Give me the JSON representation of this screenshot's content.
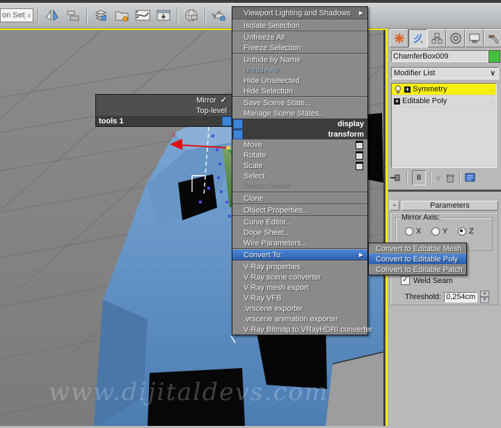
{
  "glyphs": {
    "check": "✓",
    "submenu_arrow": "▶",
    "chevron_down": "∨",
    "spinner_up": "▲",
    "spinner_down": "▼",
    "collapse": "-",
    "show_end_result": "II",
    "make_unique": "∨",
    "stack_dots": "·.",
    "plus": "+"
  },
  "toolbar": {
    "selection_set_value": "on Set",
    "icons": [
      "mirror",
      "align",
      "layer-manager",
      "scene-explorer",
      "curve-editor",
      "schematic-view",
      "render-setup",
      "rendered-frame-window",
      "render-production"
    ]
  },
  "menus": {
    "left_quad": {
      "items": [
        "Mirror",
        "Top-level"
      ],
      "bar": "tools 1"
    },
    "bars": {
      "display": "display",
      "transform": "transform"
    },
    "display_items": [
      "Viewport Lighting and Shadows",
      "Isolate Selection",
      "Unfreeze All",
      "Freeze Selection",
      "Unhide by Name",
      "Unhide All",
      "Hide Unselected",
      "Hide Selection",
      "Save Scene State...",
      "Manage Scene States..."
    ],
    "transform_items": [
      "Move",
      "Rotate",
      "Scale",
      "Select",
      "Select Similar",
      "Clone",
      "Object Properties...",
      "Curve Editor...",
      "Dope Sheet...",
      "Wire Parameters...",
      "Convert To:",
      "V-Ray properties",
      "V-Ray scene converter",
      "V-Ray mesh export",
      "V-Ray VFB",
      ".vrscene exporter",
      ".vrscene animation exporter",
      "V-Ray Bitmap to VRayHDRI converter"
    ],
    "submenu_items": [
      "Convert to Editable Mesh",
      "Convert to Editable Poly",
      "Convert to Editable Patch"
    ],
    "highlighted_item": "Convert To:",
    "highlighted_submenu_item": "Convert to Editable Poly"
  },
  "viewport": {
    "axis_label": "x"
  },
  "panel": {
    "tabs": [
      "create",
      "modify",
      "hierarchy",
      "motion",
      "display",
      "utilities"
    ],
    "selected_tab": "modify",
    "object_name": "ChamferBox009",
    "modifier_list": "Modifier List",
    "stack": [
      "Symmetry",
      "Editable Poly"
    ],
    "stack_selected": "Symmetry",
    "rollout": {
      "title": "Parameters"
    },
    "mirror_axis": {
      "label": "Mirror Axis:",
      "options": [
        "X",
        "Y",
        "Z"
      ],
      "selected": "Z"
    },
    "weld_seam_label": "Weld Seam",
    "weld_seam_checked": true,
    "threshold_label": "Threshold:",
    "threshold_value": "0,254cm"
  },
  "watermark": "www.dijitaldevs.com",
  "colors": {
    "menu_highlight": "#3a76c8",
    "quad_square_blue": "#3d85d8",
    "stack_selected_yellow": "#f7ef0e",
    "swatch_green": "#44c13c",
    "viewport_border_yellow": "#f2ee00"
  }
}
